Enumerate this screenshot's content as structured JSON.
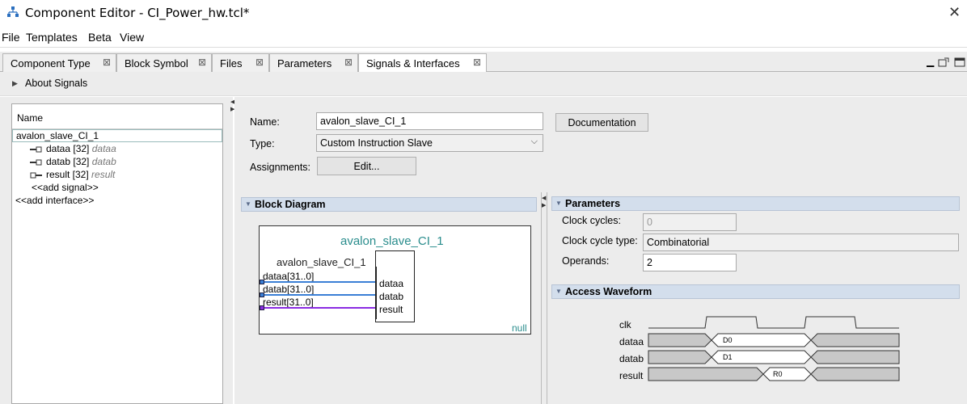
{
  "window": {
    "title": "Component Editor - CI_Power_hw.tcl*",
    "close_icon": "close-icon"
  },
  "menu": [
    "File",
    "Templates",
    "Beta",
    "View"
  ],
  "tabs": [
    {
      "label": "Component Type"
    },
    {
      "label": "Block Symbol"
    },
    {
      "label": "Files"
    },
    {
      "label": "Parameters"
    },
    {
      "label": "Signals & Interfaces",
      "active": true
    }
  ],
  "about": {
    "label": "About Signals"
  },
  "tree": {
    "header": "Name",
    "interface": "avalon_slave_CI_1",
    "signals": [
      {
        "name": "dataa [32]",
        "role": "dataa",
        "dir": "in"
      },
      {
        "name": "datab [32]",
        "role": "datab",
        "dir": "in"
      },
      {
        "name": "result [32]",
        "role": "result",
        "dir": "out"
      }
    ],
    "add_signal": "<<add signal>>",
    "add_interface": "<<add interface>>"
  },
  "form": {
    "name_label": "Name:",
    "name_value": "avalon_slave_CI_1",
    "doc_button": "Documentation",
    "type_label": "Type:",
    "type_value": "Custom Instruction Slave",
    "assign_label": "Assignments:",
    "edit_button": "Edit..."
  },
  "block_diagram": {
    "title": "Block Diagram",
    "component_name": "avalon_slave_CI_1",
    "interface_name": "avalon_slave_CI_1",
    "ports_left": [
      "dataa[31..0]",
      "datab[31..0]",
      "result[31..0]"
    ],
    "ports_right": [
      "dataa",
      "datab",
      "result"
    ],
    "footer": "null"
  },
  "parameters": {
    "title": "Parameters",
    "clock_cycles_label": "Clock cycles:",
    "clock_cycles_value": "0",
    "clock_type_label": "Clock cycle type:",
    "clock_type_value": "Combinatorial",
    "operands_label": "Operands:",
    "operands_value": "2"
  },
  "waveform": {
    "title": "Access Waveform",
    "signals": [
      "clk",
      "dataa",
      "datab",
      "result"
    ],
    "values": {
      "dataa": "D0",
      "datab": "D1",
      "result": "R0"
    }
  },
  "colors": {
    "input_line": "#3a7fd6",
    "output_line": "#8a2be2",
    "teal": "#2a8d8d",
    "section_bg": "#d3deec"
  }
}
